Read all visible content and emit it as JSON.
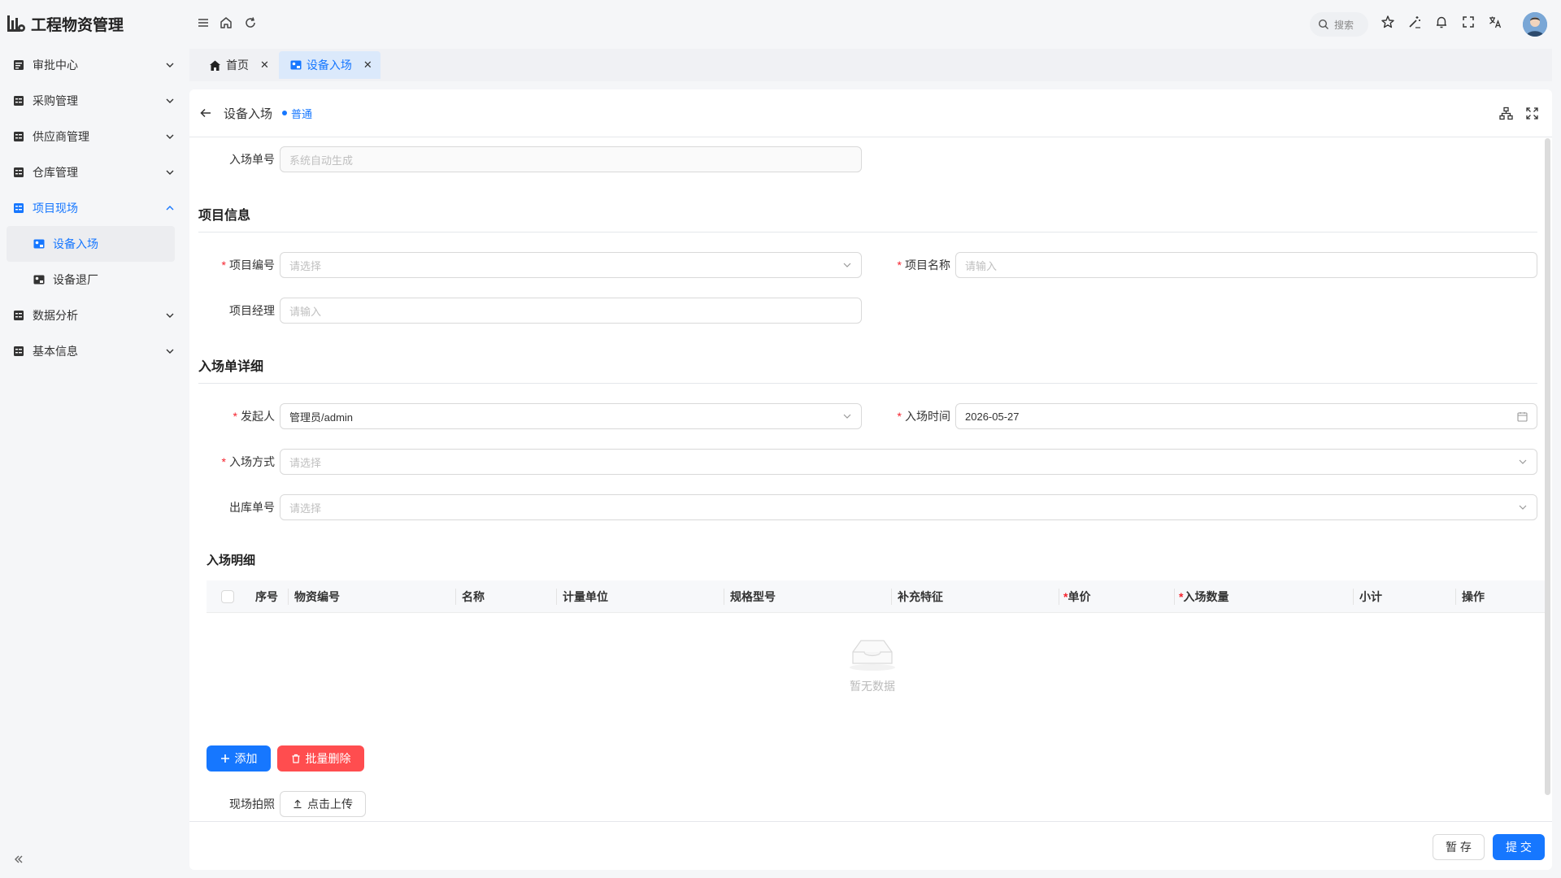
{
  "app": {
    "title": "工程物资管理"
  },
  "sidebar": {
    "items": [
      {
        "label": "审批中心",
        "icon": "document-icon"
      },
      {
        "label": "采购管理",
        "icon": "form-icon"
      },
      {
        "label": "供应商管理",
        "icon": "form-icon"
      },
      {
        "label": "仓库管理",
        "icon": "form-icon"
      },
      {
        "label": "项目现场",
        "icon": "form-icon",
        "expanded": true,
        "children": [
          {
            "label": "设备入场",
            "selected": true
          },
          {
            "label": "设备退厂"
          }
        ]
      },
      {
        "label": "数据分析",
        "icon": "form-icon"
      },
      {
        "label": "基本信息",
        "icon": "form-icon"
      }
    ]
  },
  "header": {
    "search_placeholder": "搜索"
  },
  "tabs": [
    {
      "label": "首页",
      "icon": "home-icon"
    },
    {
      "label": "设备入场",
      "icon": "equipment-icon",
      "active": true
    }
  ],
  "page": {
    "title": "设备入场",
    "status": "普通",
    "accent": "#1677ff",
    "danger": "#ff4d4f"
  },
  "form": {
    "entry_no": {
      "label": "入场单号",
      "placeholder": "系统自动生成"
    },
    "section_project": "项目信息",
    "project_code": {
      "label": "项目编号",
      "placeholder": "请选择",
      "required": true
    },
    "project_name": {
      "label": "项目名称",
      "placeholder": "请输入",
      "required": true
    },
    "project_manager": {
      "label": "项目经理",
      "placeholder": "请输入"
    },
    "section_detail": "入场单详细",
    "initiator": {
      "label": "发起人",
      "value": "管理员/admin",
      "required": true
    },
    "entry_time": {
      "label": "入场时间",
      "value": "2026-05-27",
      "required": true
    },
    "entry_method": {
      "label": "入场方式",
      "placeholder": "请选择",
      "required": true
    },
    "outbound_no": {
      "label": "出库单号",
      "placeholder": "请选择"
    },
    "section_items": "入场明细",
    "photos": {
      "label": "现场拍照",
      "upload": "点击上传"
    }
  },
  "table": {
    "columns": [
      {
        "label": "序号"
      },
      {
        "label": "物资编号"
      },
      {
        "label": "名称"
      },
      {
        "label": "计量单位"
      },
      {
        "label": "规格型号"
      },
      {
        "label": "补充特征"
      },
      {
        "label": "单价",
        "required": true
      },
      {
        "label": "入场数量",
        "required": true
      },
      {
        "label": "小计"
      },
      {
        "label": "操作"
      }
    ],
    "empty_text": "暂无数据"
  },
  "actions": {
    "add": "添加",
    "batch_delete": "批量删除",
    "save_draft": "暂 存",
    "submit": "提 交"
  }
}
